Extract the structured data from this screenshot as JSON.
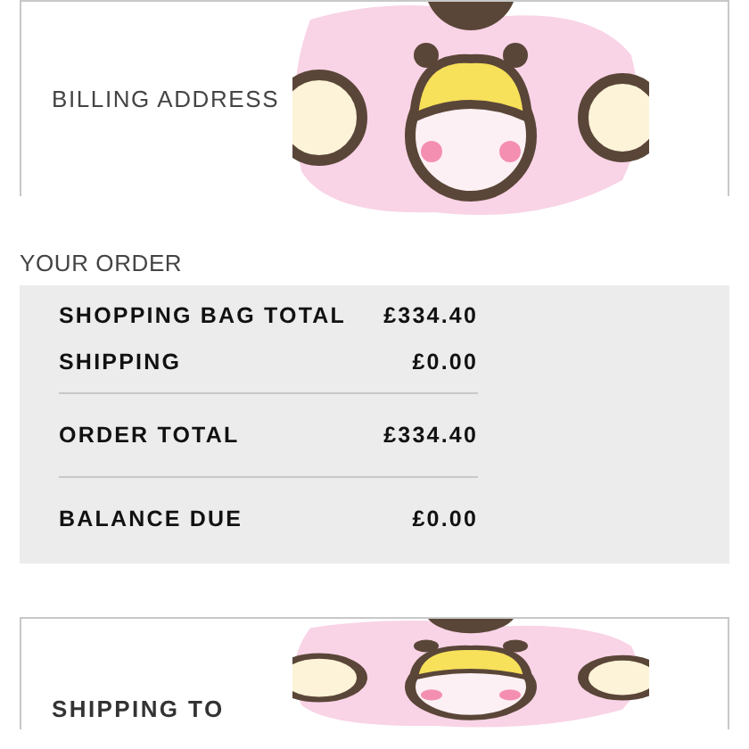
{
  "billing": {
    "label": "BILLING ADDRESS"
  },
  "order": {
    "title": "YOUR ORDER",
    "rows": [
      {
        "kind": "item",
        "label": "SHOPPING BAG TOTAL",
        "value": "£334.40"
      },
      {
        "kind": "item",
        "label": "SHIPPING",
        "value": "£0.00"
      },
      {
        "kind": "total",
        "label": "ORDER TOTAL",
        "value": "£334.40"
      },
      {
        "kind": "total",
        "label": "BALANCE DUE",
        "value": "£0.00"
      }
    ]
  },
  "shipping": {
    "label": "SHIPPING TO"
  }
}
